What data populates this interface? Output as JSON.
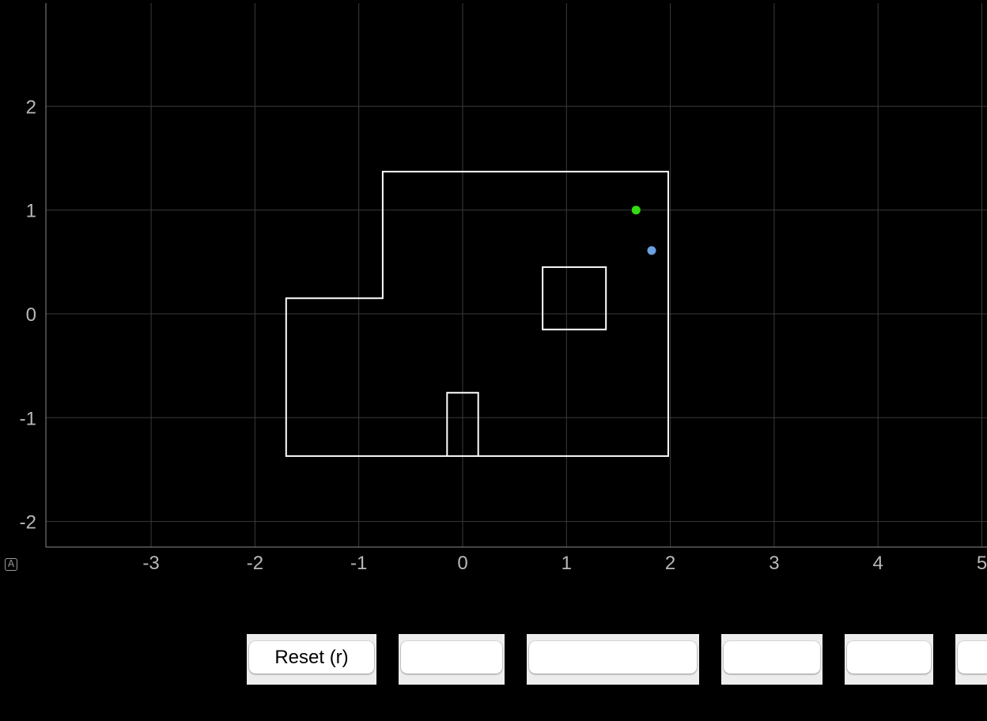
{
  "plot": {
    "x_range": [
      -4,
      5
    ],
    "y_range": [
      -2.3,
      3
    ],
    "x_ticks": [
      "-3",
      "-2",
      "-1",
      "0",
      "1",
      "2",
      "3",
      "4",
      "5"
    ],
    "y_ticks": [
      "-2",
      "-1",
      "0",
      "1",
      "2"
    ],
    "x_tick_values": [
      -3,
      -2,
      -1,
      0,
      1,
      2,
      3,
      4,
      5
    ],
    "y_tick_values": [
      -2,
      -1,
      0,
      1,
      2
    ],
    "grid": true,
    "colors": {
      "background": "#000000",
      "grid": "#3a3a3a",
      "axis": "#8a8a8a",
      "walls": "#ffffff",
      "goal_dot": "#33dd11",
      "agent_dot": "#6a9fe0"
    },
    "walls": {
      "outer": [
        [
          -1.7,
          0.15
        ],
        [
          -0.77,
          0.15
        ],
        [
          -0.77,
          1.37
        ],
        [
          1.98,
          1.37
        ],
        [
          1.98,
          -1.37
        ],
        [
          -1.7,
          -1.37
        ]
      ],
      "obstacle_square": [
        [
          0.77,
          0.45
        ],
        [
          1.38,
          0.45
        ],
        [
          1.38,
          -0.15
        ],
        [
          0.77,
          -0.15
        ]
      ],
      "obstacle_notch": [
        [
          -0.15,
          -1.37
        ],
        [
          -0.15,
          -0.76
        ],
        [
          0.15,
          -0.76
        ],
        [
          0.15,
          -1.37
        ]
      ]
    },
    "markers": [
      {
        "name": "goal",
        "x": 1.67,
        "y": 1.0,
        "color": "#33dd11"
      },
      {
        "name": "agent",
        "x": 1.82,
        "y": 0.61,
        "color": "#6a9fe0"
      }
    ]
  },
  "corner_icon": {
    "glyph": "A",
    "icon": "autoscale-icon"
  },
  "buttons": [
    {
      "name": "reset-button",
      "label": "Reset (r)"
    },
    {
      "name": "button-2",
      "label": ""
    },
    {
      "name": "button-3",
      "label": ""
    },
    {
      "name": "button-4",
      "label": ""
    },
    {
      "name": "button-5",
      "label": ""
    },
    {
      "name": "button-6",
      "label": ""
    }
  ]
}
